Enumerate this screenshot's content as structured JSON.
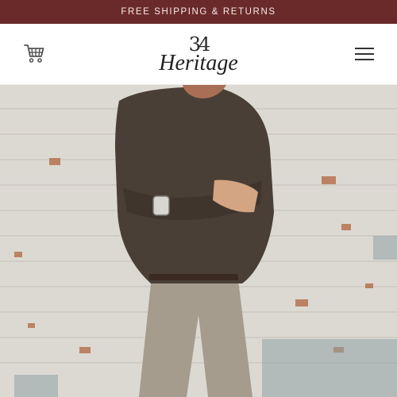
{
  "announcement": {
    "text": "FREE SHIPPING & RETURNS"
  },
  "header": {
    "cart_icon": "cart-icon",
    "logo": {
      "number": "34",
      "word": "Heritage"
    },
    "menu_icon": "hamburger-menu-icon"
  },
  "hero": {
    "image": "model-crossed-arms-brick-wall"
  },
  "colors": {
    "announcement_bg": "#6b2a2a",
    "announcement_text": "#f4e9e6",
    "header_bg": "#ffffff",
    "sweater": "#4a3f36",
    "pants": "#a59c8d",
    "brick_wall": "#d8d5cf"
  }
}
